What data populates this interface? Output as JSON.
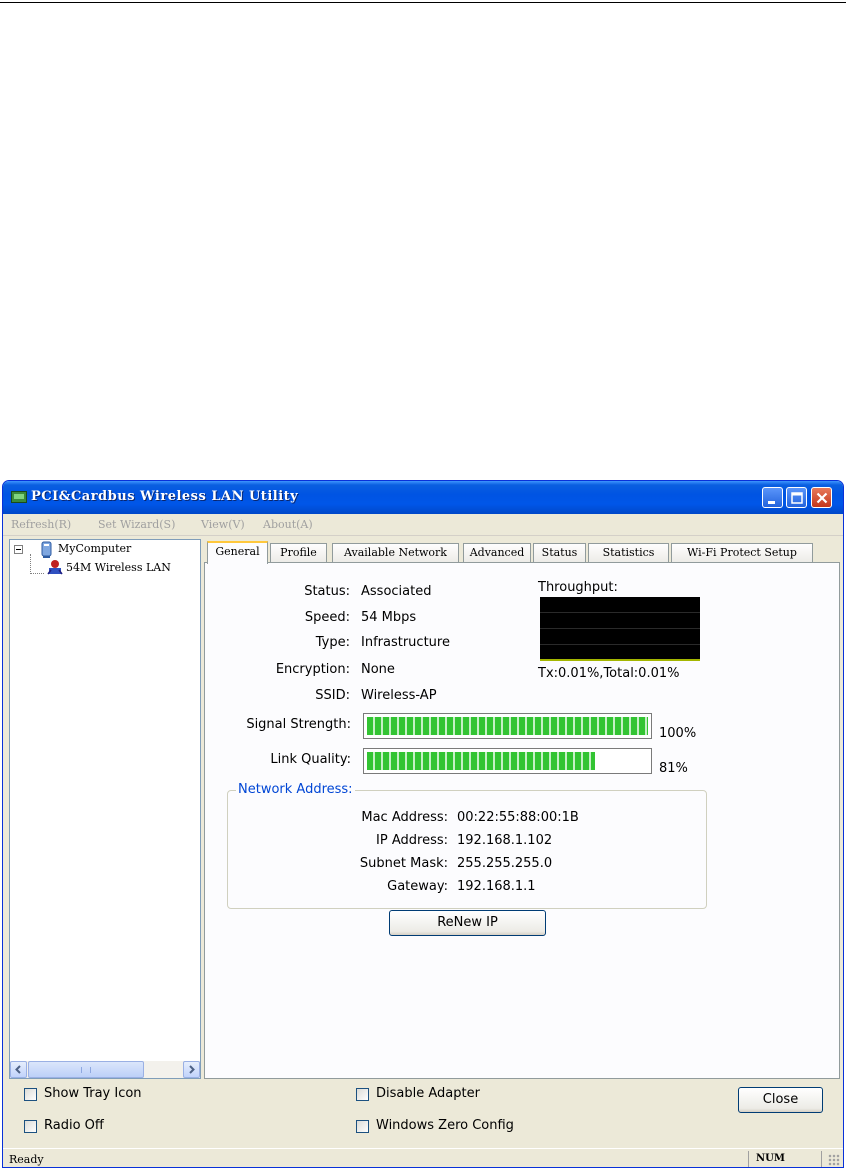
{
  "window": {
    "title": "PCI&Cardbus Wireless LAN Utility"
  },
  "menu": {
    "items": [
      "Refresh(R)",
      "Set Wizard(S)",
      "View(V)",
      "About(A)"
    ]
  },
  "tree": {
    "root": "MyComputer",
    "child": "54M Wireless LAN"
  },
  "tabs": [
    "General",
    "Profile",
    "Available Network",
    "Advanced",
    "Status",
    "Statistics",
    "Wi-Fi Protect Setup"
  ],
  "general": {
    "fields": [
      {
        "label": "Status:",
        "value": "Associated"
      },
      {
        "label": "Speed:",
        "value": "54 Mbps"
      },
      {
        "label": "Type:",
        "value": "Infrastructure"
      },
      {
        "label": "Encryption:",
        "value": "None"
      },
      {
        "label": "SSID:",
        "value": "Wireless-AP"
      }
    ],
    "throughput_label": "Throughput:",
    "throughput_value": "Tx:0.01%,Total:0.01%",
    "signal_label": "Signal Strength:",
    "signal_percent": 100,
    "signal_text": "100%",
    "link_label": "Link Quality:",
    "link_percent": 81,
    "link_text": "81%",
    "bar_color": "#33c433"
  },
  "network": {
    "title": "Network Address:",
    "fields": [
      {
        "label": "Mac Address:",
        "value": "00:22:55:88:00:1B"
      },
      {
        "label": "IP Address:",
        "value": "192.168.1.102"
      },
      {
        "label": "Subnet Mask:",
        "value": "255.255.255.0"
      },
      {
        "label": "Gateway:",
        "value": "192.168.1.1"
      }
    ]
  },
  "buttons": {
    "renew": "ReNew IP",
    "close": "Close"
  },
  "options": {
    "show_tray_icon": "Show Tray Icon",
    "radio_off": "Radio Off",
    "disable_adapter": "Disable Adapter",
    "windows_zero_config": "Windows Zero Config"
  },
  "statusbar": {
    "text": "Ready",
    "num": "NUM"
  },
  "colors": {
    "title_blue": "#0054e3",
    "group_title": "#0046d5",
    "tab_highlight": "#ffc83c"
  }
}
